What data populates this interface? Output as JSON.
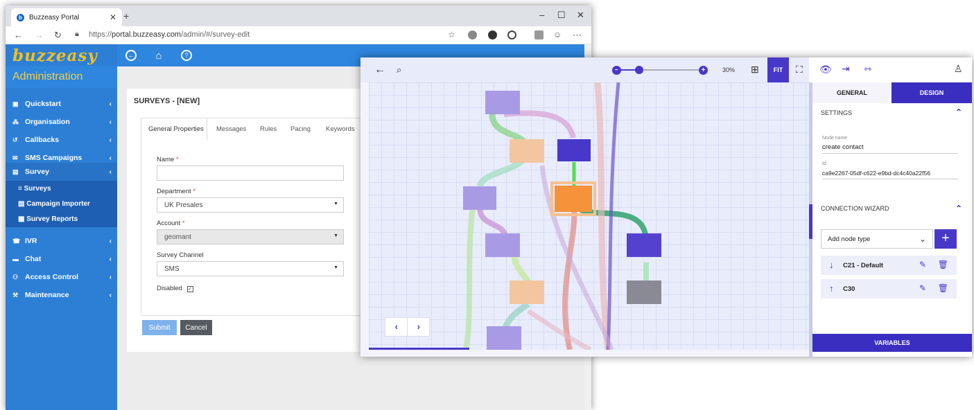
{
  "browser": {
    "tab_title": "Buzzeasy Portal",
    "url_prefix": "https://",
    "url_host": "portal.buzzeasy.com",
    "url_path": "/admin/#/survey-edit"
  },
  "app": {
    "logo": "buzzeasy",
    "section_title": "Administration"
  },
  "sidebar": {
    "items": [
      {
        "label": "Quickstart",
        "icon": "quickstart-icon"
      },
      {
        "label": "Organisation",
        "icon": "organisation-icon"
      },
      {
        "label": "Callbacks",
        "icon": "callbacks-icon"
      },
      {
        "label": "SMS Campaigns",
        "icon": "sms-icon"
      },
      {
        "label": "Survey",
        "icon": "survey-icon"
      },
      {
        "label": "IVR",
        "icon": "ivr-icon"
      },
      {
        "label": "Chat",
        "icon": "chat-icon"
      },
      {
        "label": "Access Control",
        "icon": "access-control-icon"
      },
      {
        "label": "Maintenance",
        "icon": "maintenance-icon"
      }
    ],
    "survey_subitems": [
      {
        "label": "Surveys"
      },
      {
        "label": "Campaign Importer"
      },
      {
        "label": "Survey Reports"
      }
    ]
  },
  "page": {
    "title": "SURVEYS - [NEW]",
    "tabs": [
      "General Properties",
      "Messages",
      "Rules",
      "Pacing",
      "Keywords"
    ],
    "fields": {
      "name_label": "Name",
      "name_value": "",
      "department_label": "Department",
      "department_value": "UK Presales",
      "account_label": "Account",
      "account_value": "geomant",
      "channel_label": "Survey Channel",
      "channel_value": "SMS",
      "disabled_label": "Disabled",
      "required_mark": "*"
    },
    "submit_label": "Submit",
    "cancel_label": "Cancel"
  },
  "designer": {
    "zoom_level": "30%",
    "fit_label": "FIT",
    "tabs": {
      "general": "GENERAL",
      "design": "DESIGN"
    },
    "settings_title": "SETTINGS",
    "node_name_label": "Node name",
    "node_name_value": "create contact",
    "id_label": "Id",
    "id_value": "ca9e2267-05df-c622-e9bd-dc4c40a22f56",
    "connection_wizard_title": "CONNECTION WIZARD",
    "add_node_placeholder": "Add node type",
    "connections": [
      {
        "direction": "down",
        "name": "C21 - Default"
      },
      {
        "direction": "up",
        "name": "C30"
      }
    ],
    "variables_label": "VARIABLES"
  },
  "colors": {
    "sidebar_blue": "#2d7fd6",
    "accent_purple": "#4838c9",
    "logo_yellow": "#f0c020",
    "selected_node_orange": "#f5923a"
  }
}
